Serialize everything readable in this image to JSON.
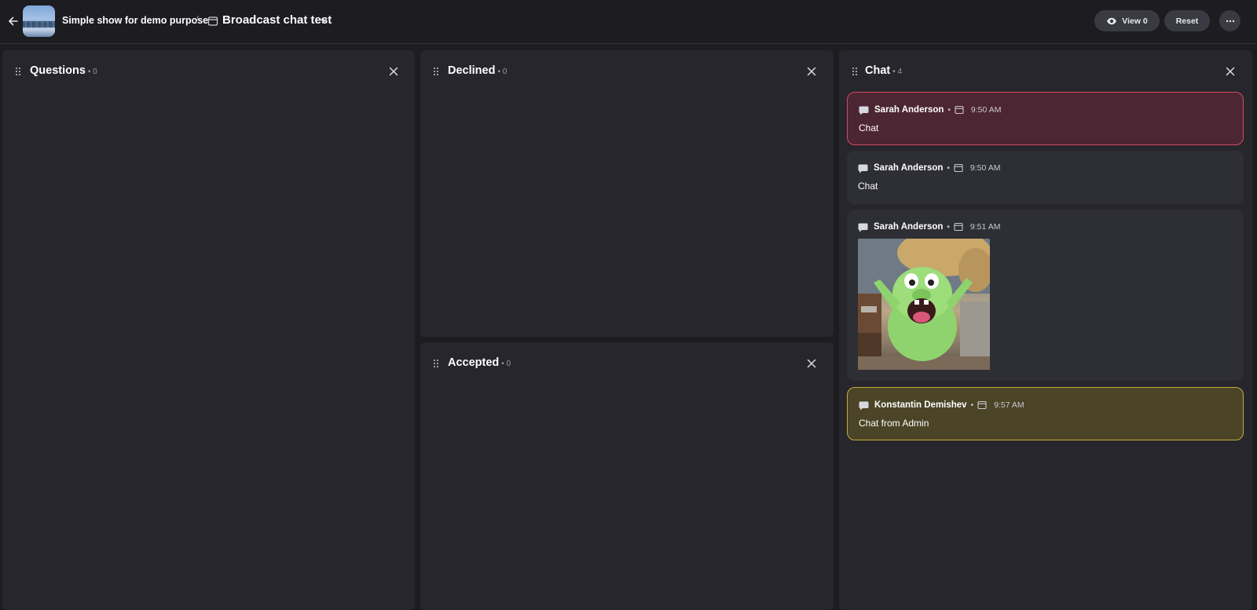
{
  "header": {
    "show_name": "Simple show for demo purpose",
    "separator": "/",
    "event_title": "Broadcast chat test",
    "view_label": "View 0",
    "reset_label": "Reset"
  },
  "panels": {
    "questions": {
      "title": "Questions",
      "count": "• 0"
    },
    "declined": {
      "title": "Declined",
      "count": "• 0"
    },
    "accepted": {
      "title": "Accepted",
      "count": "• 0"
    },
    "chat": {
      "title": "Chat",
      "count": "• 4"
    }
  },
  "chat": {
    "messages": [
      {
        "author": "Sarah Anderson",
        "sep": "•",
        "time": "9:50 AM",
        "text": "Chat",
        "style": "flagged"
      },
      {
        "author": "Sarah Anderson",
        "sep": "•",
        "time": "9:50 AM",
        "text": "Chat",
        "style": "normal"
      },
      {
        "author": "Sarah Anderson",
        "sep": "•",
        "time": "9:51 AM",
        "text": "",
        "style": "image"
      },
      {
        "author": "Konstantin Demishev",
        "sep": "•",
        "time": "9:57 AM",
        "text": "Chat from Admin",
        "style": "admin"
      }
    ]
  },
  "colors": {
    "background": "#1c1c21",
    "panel": "#26262c",
    "flagged_border": "#d24a63",
    "admin_border": "#c5ab3b"
  },
  "icons": {
    "back": "arrow-left-icon",
    "event": "calendar-icon",
    "dropdown": "chevron-down-icon",
    "view": "eye-icon",
    "more": "more-horizontal-icon",
    "drag": "drag-handle-icon",
    "close": "close-icon",
    "message": "chat-bubble-icon",
    "source": "window-icon"
  }
}
